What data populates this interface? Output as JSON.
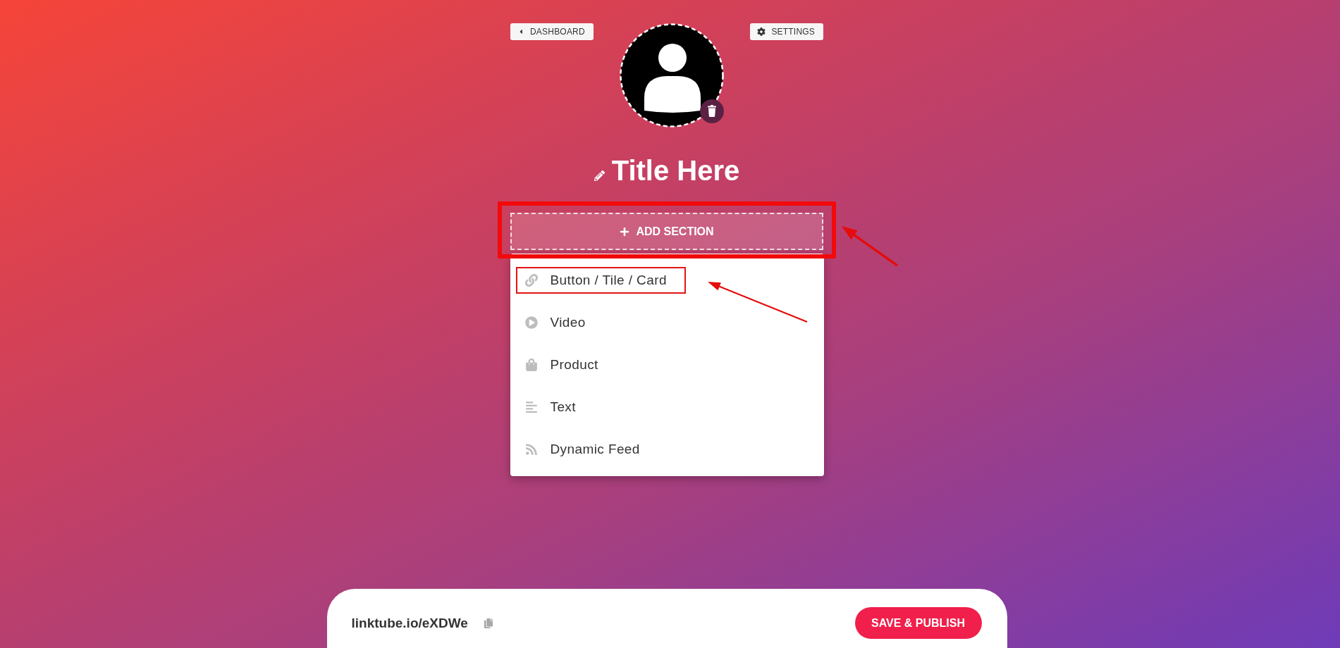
{
  "nav": {
    "back_button": {
      "label": "DASHBOARD"
    },
    "settings_button": {
      "label": "SETTINGS"
    }
  },
  "profile": {
    "title": "Title Here"
  },
  "add_section": {
    "label": "ADD SECTION",
    "highlighted": true,
    "expanded": true
  },
  "section_menu": {
    "items": [
      {
        "kind": "link",
        "label": "Button / Tile / Card",
        "highlighted": true
      },
      {
        "kind": "video",
        "label": "Video",
        "highlighted": false
      },
      {
        "kind": "product",
        "label": "Product",
        "highlighted": false
      },
      {
        "kind": "text",
        "label": "Text",
        "highlighted": false
      },
      {
        "kind": "feed",
        "label": "Dynamic Feed",
        "highlighted": false
      }
    ]
  },
  "footer": {
    "url": "linktube.io/eXDWe",
    "publish_button": {
      "label": "SAVE & PUBLISH"
    }
  }
}
